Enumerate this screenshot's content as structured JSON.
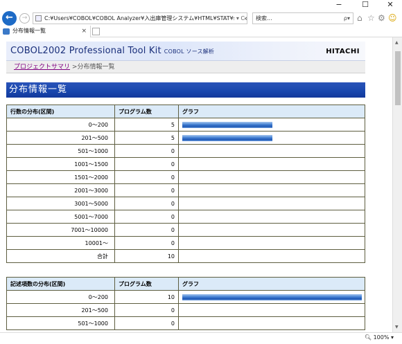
{
  "window": {
    "minimize": "−",
    "maximize": "☐",
    "close": "✕"
  },
  "addressbar": {
    "url": "C:¥Users¥COBOL¥COBOL Analyzer¥入出庫管理システム¥HTML¥STAT¥stepcountc",
    "controls": "▾ C",
    "search_placeholder": "検索...",
    "search_controls": "ρ▾"
  },
  "tab": {
    "title": "分布情報一覧",
    "close": "×"
  },
  "header": {
    "product": "COBOL2002 Professional Tool Kit",
    "subtitle": "COBOL ソース解析",
    "brand": "HITACHI"
  },
  "breadcrumb": {
    "link": "プロジェクトサマリ",
    "separator": ">",
    "current": "分布情報一覧"
  },
  "page_title": "分布情報一覧",
  "colors": {
    "bar": "#1c56b4",
    "title_bg": "#1846ad",
    "header_bg": "#dbeaf8",
    "link": "#800080"
  },
  "chart_data": [
    {
      "type": "table",
      "title": "行数の分布(区間)",
      "headers": [
        "行数の分布(区間)",
        "プログラム数",
        "グラフ"
      ],
      "rows": [
        {
          "range": "0〜200",
          "count": "5",
          "share": 0.5
        },
        {
          "range": "201〜500",
          "count": "5",
          "share": 0.5
        },
        {
          "range": "501〜1000",
          "count": "0",
          "share": 0
        },
        {
          "range": "1001〜1500",
          "count": "0",
          "share": 0
        },
        {
          "range": "1501〜2000",
          "count": "0",
          "share": 0
        },
        {
          "range": "2001〜3000",
          "count": "0",
          "share": 0
        },
        {
          "range": "3001〜5000",
          "count": "0",
          "share": 0
        },
        {
          "range": "5001〜7000",
          "count": "0",
          "share": 0
        },
        {
          "range": "7001〜10000",
          "count": "0",
          "share": 0
        },
        {
          "range": "10001〜",
          "count": "0",
          "share": 0
        },
        {
          "range": "合計",
          "count": "10",
          "share": 0
        }
      ]
    },
    {
      "type": "table",
      "title": "記述項数の分布(区間)",
      "headers": [
        "記述項数の分布(区間)",
        "プログラム数",
        "グラフ"
      ],
      "rows": [
        {
          "range": "0〜200",
          "count": "10",
          "share": 1.0
        },
        {
          "range": "201〜500",
          "count": "0",
          "share": 0
        },
        {
          "range": "501〜1000",
          "count": "0",
          "share": 0
        }
      ]
    }
  ],
  "statusbar": {
    "zoom": "100%"
  }
}
